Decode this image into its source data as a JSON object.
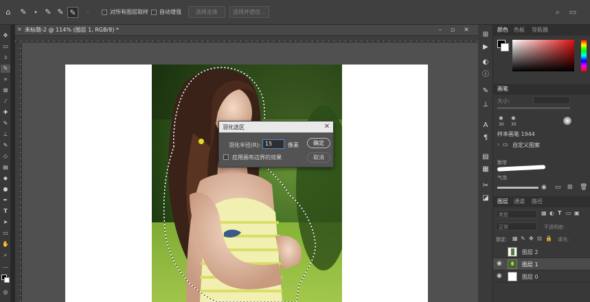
{
  "options_bar": {
    "checkbox_sample_all": "对所有图层取样",
    "checkbox_auto_enhance": "自动增强",
    "select_subject": "选择主体",
    "select_and_mask": "选择并遮住..."
  },
  "document": {
    "tab_title": "未标题-2 @ 114% (图层 1, RGB/8) *"
  },
  "dialog": {
    "title": "羽化选区",
    "radius_label": "羽化半径(R):",
    "radius_value": "15",
    "unit": "像素",
    "ok": "确定",
    "cancel": "取消",
    "checkbox_label": "应用画布边界的效果"
  },
  "right_panel": {
    "color_tabs": [
      "颜色",
      "色板",
      "导航器"
    ],
    "brush_tab": "画笔",
    "brush_size_label": "大小:",
    "brush_sizes": [
      "30",
      "30"
    ],
    "brush_preset": "样本画笔 1944",
    "folder_label": "自定义图案",
    "brush_item_1": "飘带",
    "brush_item_2": "气泡",
    "layers_tabs": [
      "图层",
      "通道",
      "路径"
    ],
    "kind_label": "类型",
    "blend_mode": "正常",
    "opacity_label": "不透明度:",
    "lock_label": "锁定:",
    "fill_label": "填充:",
    "layers": [
      {
        "name": "图层 2",
        "visible": false
      },
      {
        "name": "图层 1",
        "visible": true
      },
      {
        "name": "图层 0",
        "visible": true
      }
    ]
  },
  "colors": {
    "accent": "#4a8fdc",
    "panel": "#383838",
    "selected_layer": "#4b4b4b"
  }
}
